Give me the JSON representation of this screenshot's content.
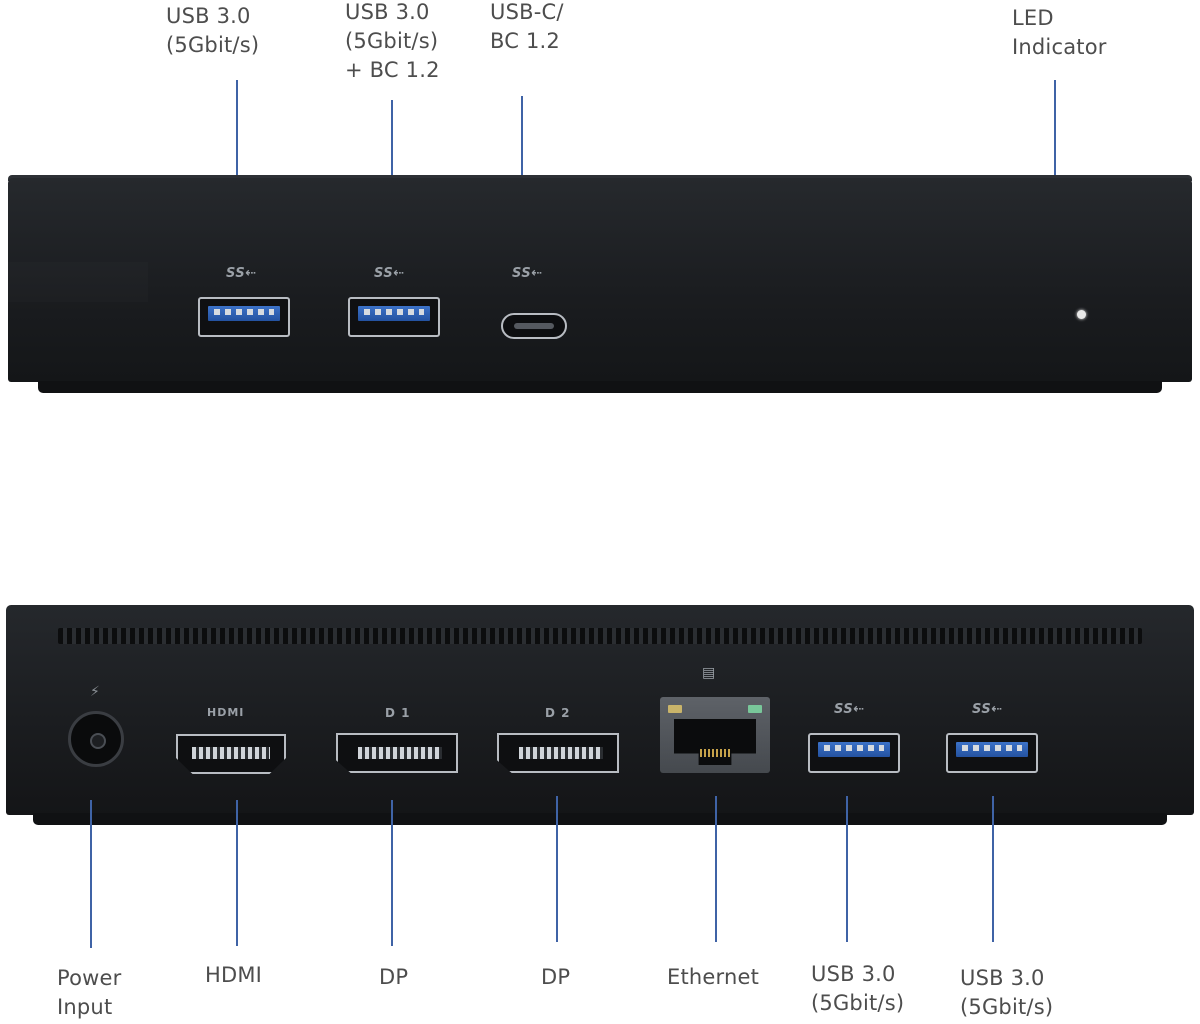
{
  "front_labels": {
    "usb_a": "USB 3.0\n(5Gbit/s)",
    "usb_a_bc": "USB 3.0\n(5Gbit/s)\n+ BC 1.2",
    "usb_c": "USB-C/\nBC 1.2",
    "led": "LED\nIndicator"
  },
  "rear_labels": {
    "power": "Power\nInput",
    "hdmi": "HDMI",
    "dp1": "DP",
    "dp2": "DP",
    "ethernet": "Ethernet",
    "usb1": "USB 3.0\n(5Gbit/s)",
    "usb2": "USB 3.0\n(5Gbit/s)"
  },
  "port_marks": {
    "ss": "SS⇠",
    "hdmi": "HDMI",
    "dp1": "D 1",
    "dp2": "D 2"
  },
  "colors": {
    "leader": "#3f63a6",
    "label": "#4d4d4d",
    "chassis": "#1b1d20"
  }
}
